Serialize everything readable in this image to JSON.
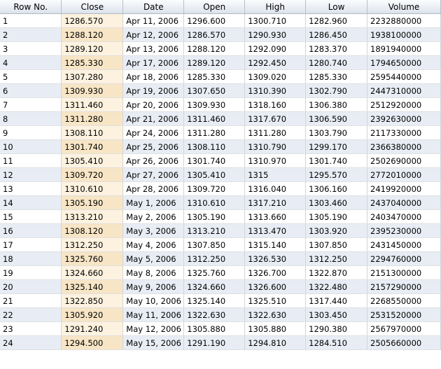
{
  "table": {
    "columns": [
      "Row No.",
      "Close",
      "Date",
      "Open",
      "High",
      "Low",
      "Volume"
    ],
    "rows": [
      [
        "1",
        "1286.570",
        "Apr 11, 2006",
        "1296.600",
        "1300.710",
        "1282.960",
        "2232880000"
      ],
      [
        "2",
        "1288.120",
        "Apr 12, 2006",
        "1286.570",
        "1290.930",
        "1286.450",
        "1938100000"
      ],
      [
        "3",
        "1289.120",
        "Apr 13, 2006",
        "1288.120",
        "1292.090",
        "1283.370",
        "1891940000"
      ],
      [
        "4",
        "1285.330",
        "Apr 17, 2006",
        "1289.120",
        "1292.450",
        "1280.740",
        "1794650000"
      ],
      [
        "5",
        "1307.280",
        "Apr 18, 2006",
        "1285.330",
        "1309.020",
        "1285.330",
        "2595440000"
      ],
      [
        "6",
        "1309.930",
        "Apr 19, 2006",
        "1307.650",
        "1310.390",
        "1302.790",
        "2447310000"
      ],
      [
        "7",
        "1311.460",
        "Apr 20, 2006",
        "1309.930",
        "1318.160",
        "1306.380",
        "2512920000"
      ],
      [
        "8",
        "1311.280",
        "Apr 21, 2006",
        "1311.460",
        "1317.670",
        "1306.590",
        "2392630000"
      ],
      [
        "9",
        "1308.110",
        "Apr 24, 2006",
        "1311.280",
        "1311.280",
        "1303.790",
        "2117330000"
      ],
      [
        "10",
        "1301.740",
        "Apr 25, 2006",
        "1308.110",
        "1310.790",
        "1299.170",
        "2366380000"
      ],
      [
        "11",
        "1305.410",
        "Apr 26, 2006",
        "1301.740",
        "1310.970",
        "1301.740",
        "2502690000"
      ],
      [
        "12",
        "1309.720",
        "Apr 27, 2006",
        "1305.410",
        "1315",
        "1295.570",
        "2772010000"
      ],
      [
        "13",
        "1310.610",
        "Apr 28, 2006",
        "1309.720",
        "1316.040",
        "1306.160",
        "2419920000"
      ],
      [
        "14",
        "1305.190",
        "May 1, 2006",
        "1310.610",
        "1317.210",
        "1303.460",
        "2437040000"
      ],
      [
        "15",
        "1313.210",
        "May 2, 2006",
        "1305.190",
        "1313.660",
        "1305.190",
        "2403470000"
      ],
      [
        "16",
        "1308.120",
        "May 3, 2006",
        "1313.210",
        "1313.470",
        "1303.920",
        "2395230000"
      ],
      [
        "17",
        "1312.250",
        "May 4, 2006",
        "1307.850",
        "1315.140",
        "1307.850",
        "2431450000"
      ],
      [
        "18",
        "1325.760",
        "May 5, 2006",
        "1312.250",
        "1326.530",
        "1312.250",
        "2294760000"
      ],
      [
        "19",
        "1324.660",
        "May 8, 2006",
        "1325.760",
        "1326.700",
        "1322.870",
        "2151300000"
      ],
      [
        "20",
        "1325.140",
        "May 9, 2006",
        "1324.660",
        "1326.600",
        "1322.480",
        "2157290000"
      ],
      [
        "21",
        "1322.850",
        "May 10, 2006",
        "1325.140",
        "1325.510",
        "1317.440",
        "2268550000"
      ],
      [
        "22",
        "1305.920",
        "May 11, 2006",
        "1322.630",
        "1322.630",
        "1303.450",
        "2531520000"
      ],
      [
        "23",
        "1291.240",
        "May 12, 2006",
        "1305.880",
        "1305.880",
        "1290.380",
        "2567970000"
      ],
      [
        "24",
        "1294.500",
        "May 15, 2006",
        "1291.190",
        "1294.810",
        "1284.510",
        "2505660000"
      ]
    ]
  }
}
